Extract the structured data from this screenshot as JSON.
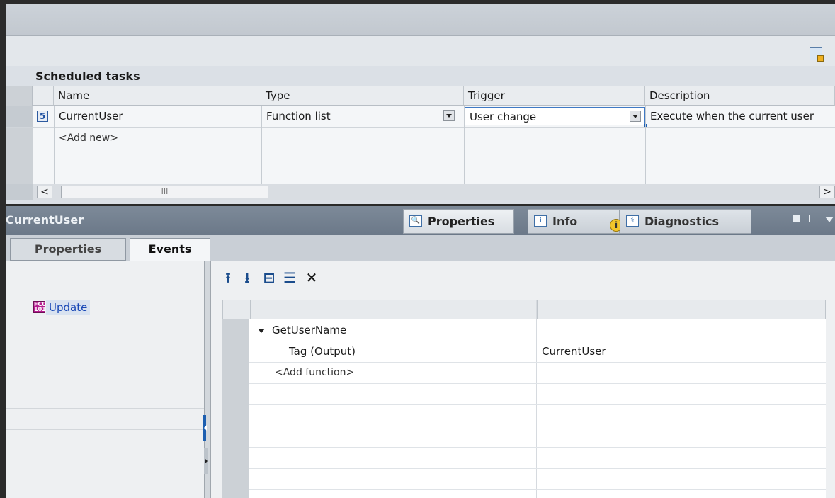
{
  "editor": {
    "section_title": "Scheduled tasks",
    "columns": [
      "Name",
      "Type",
      "Trigger",
      "Description"
    ],
    "rows": [
      {
        "number": "5",
        "name": "CurrentUser",
        "type": "Function list",
        "trigger": "User change",
        "description": "Execute when the current user"
      },
      {
        "number": "",
        "name": "<Add new>",
        "type": "",
        "trigger": "",
        "description": ""
      }
    ],
    "scroll_thumb": "III",
    "scroll_left": "<",
    "scroll_right": ">"
  },
  "inspector": {
    "object_name": "CurrentUser",
    "tabs": [
      {
        "label": "Properties",
        "icon": "properties-icon"
      },
      {
        "label": "Info",
        "icon": "info-icon"
      },
      {
        "label": "Diagnostics",
        "icon": "diagnostics-icon"
      }
    ],
    "info_badge": "i",
    "subtabs": [
      "Properties",
      "Events"
    ],
    "active_subtab": "Events",
    "events": [
      {
        "label": "Update",
        "icon": "event-icon"
      }
    ],
    "function_toolbar": [
      {
        "name": "move-up-icon",
        "glyph": "⭱"
      },
      {
        "name": "move-down-icon",
        "glyph": "⭳"
      },
      {
        "name": "expand-all-icon",
        "glyph": "⊟"
      },
      {
        "name": "collapse-all-icon",
        "glyph": "☰"
      },
      {
        "name": "delete-icon",
        "glyph": "✕"
      }
    ],
    "functions": [
      {
        "label": "GetUserName",
        "param": "",
        "value": ""
      },
      {
        "label": "",
        "param": "Tag (Output)",
        "value": "CurrentUser"
      },
      {
        "label": "<Add function>",
        "param": "",
        "value": ""
      }
    ]
  },
  "colors": {
    "accent": "#1d5fb0",
    "header_bar": "#6b7888",
    "event_icon": "#b41c8f",
    "info_badge": "#f3c52b"
  }
}
